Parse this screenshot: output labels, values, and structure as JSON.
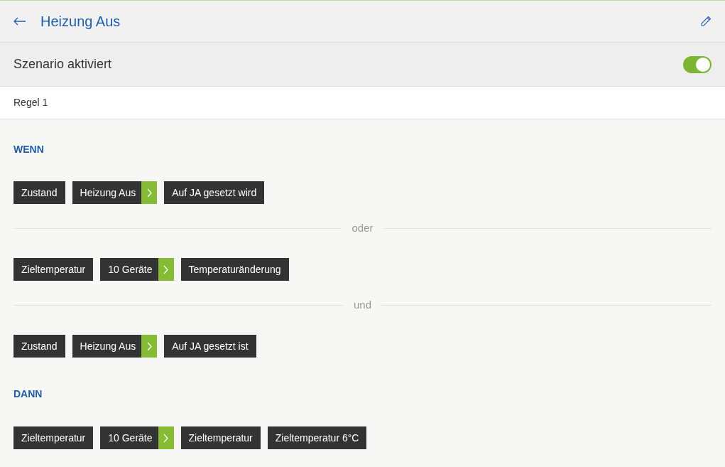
{
  "header": {
    "title": "Heizung Aus"
  },
  "scenario": {
    "label": "Szenario aktiviert",
    "on": true
  },
  "rule": {
    "title": "Regel 1"
  },
  "sections": [
    {
      "heading": "WENN",
      "items": [
        {
          "kind": "chips",
          "chips": [
            {
              "kind": "plain",
              "text": "Zustand"
            },
            {
              "kind": "device",
              "text": "Heizung Aus"
            },
            {
              "kind": "plain",
              "text": "Auf JA gesetzt wird"
            }
          ]
        },
        {
          "kind": "divider",
          "label": "oder"
        },
        {
          "kind": "chips",
          "chips": [
            {
              "kind": "plain",
              "text": "Zieltemperatur"
            },
            {
              "kind": "device",
              "text": "10 Geräte"
            },
            {
              "kind": "plain",
              "text": "Temperaturänderung"
            }
          ]
        },
        {
          "kind": "divider",
          "label": "und"
        },
        {
          "kind": "chips",
          "chips": [
            {
              "kind": "plain",
              "text": "Zustand"
            },
            {
              "kind": "device",
              "text": "Heizung Aus"
            },
            {
              "kind": "plain",
              "text": "Auf JA gesetzt ist"
            }
          ]
        }
      ]
    },
    {
      "heading": "DANN",
      "items": [
        {
          "kind": "chips",
          "chips": [
            {
              "kind": "plain",
              "text": "Zieltemperatur"
            },
            {
              "kind": "device",
              "text": "10 Geräte"
            },
            {
              "kind": "plain",
              "text": "Zieltemperatur"
            },
            {
              "kind": "plain",
              "text": "Zieltemperatur 6°C"
            }
          ]
        }
      ]
    }
  ]
}
